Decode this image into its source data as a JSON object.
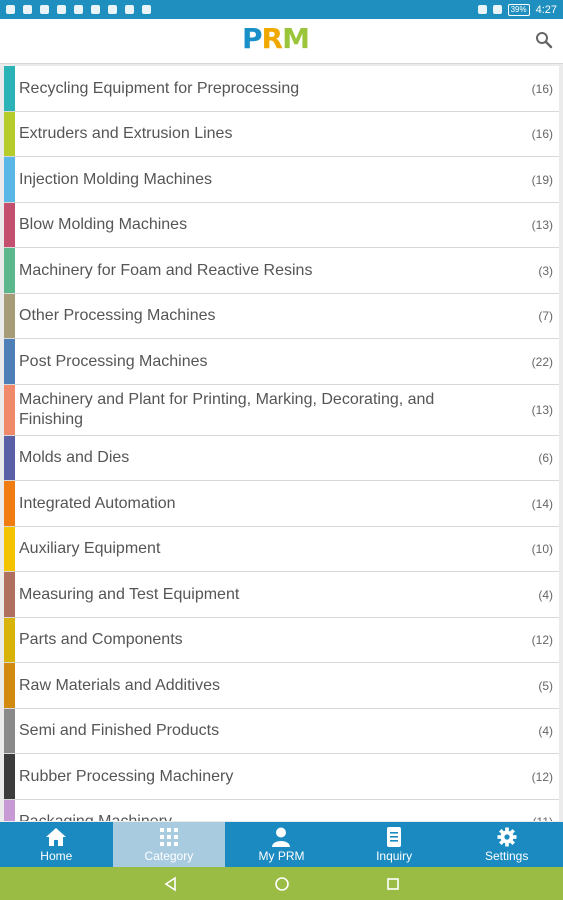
{
  "status_bar": {
    "time": "4:27",
    "battery": "39%"
  },
  "app": {
    "logo_text": [
      "P",
      "R",
      "M"
    ],
    "colors": {
      "primary": "#1a8ac0",
      "logo_blue": "#1a90c8",
      "logo_yellow": "#f0a800",
      "logo_green": "#9ac43a",
      "system_bar": "#9bbc44"
    }
  },
  "categories": [
    {
      "label": "Recycling Equipment for Preprocessing",
      "count": "(16)",
      "color": "#2bb3b8",
      "height": 46
    },
    {
      "label": "Extruders and Extrusion Lines",
      "count": "(16)",
      "color": "#b5cc2a",
      "height": 45
    },
    {
      "label": "Injection Molding Machines",
      "count": "(19)",
      "color": "#5bb8e6",
      "height": 46
    },
    {
      "label": "Blow Molding Machines",
      "count": "(13)",
      "color": "#c4506f",
      "height": 45
    },
    {
      "label": "Machinery for Foam and Reactive Resins",
      "count": "(3)",
      "color": "#5cb88c",
      "height": 46
    },
    {
      "label": "Other Processing Machines",
      "count": "(7)",
      "color": "#a69c78",
      "height": 45
    },
    {
      "label": "Post Processing Machines",
      "count": "(22)",
      "color": "#4f7fb6",
      "height": 46
    },
    {
      "label": "Machinery and Plant for Printing, Marking, Decorating, and Finishing",
      "count": "(13)",
      "color": "#f08a6a",
      "height": 51
    },
    {
      "label": "Molds and Dies",
      "count": "(6)",
      "color": "#5b5fa6",
      "height": 45
    },
    {
      "label": "Integrated Automation",
      "count": "(14)",
      "color": "#f07c12",
      "height": 46
    },
    {
      "label": "Auxiliary Equipment",
      "count": "(10)",
      "color": "#f5c400",
      "height": 45
    },
    {
      "label": "Measuring and Test Equipment",
      "count": "(4)",
      "color": "#b07060",
      "height": 46
    },
    {
      "label": "Parts and Components",
      "count": "(12)",
      "color": "#d8b40a",
      "height": 45
    },
    {
      "label": "Raw Materials and Additives",
      "count": "(5)",
      "color": "#d28a10",
      "height": 46
    },
    {
      "label": "Semi and Finished Products",
      "count": "(4)",
      "color": "#8a8a8a",
      "height": 45
    },
    {
      "label": "Rubber Processing Machinery",
      "count": "(12)",
      "color": "#3c3c3c",
      "height": 46
    },
    {
      "label": "Packaging Machinery",
      "count": "(11)",
      "color": "#c79ad6",
      "height": 45
    }
  ],
  "nav": {
    "home": "Home",
    "category": "Category",
    "my_prm": "My PRM",
    "inquiry": "Inquiry",
    "settings": "Settings"
  }
}
